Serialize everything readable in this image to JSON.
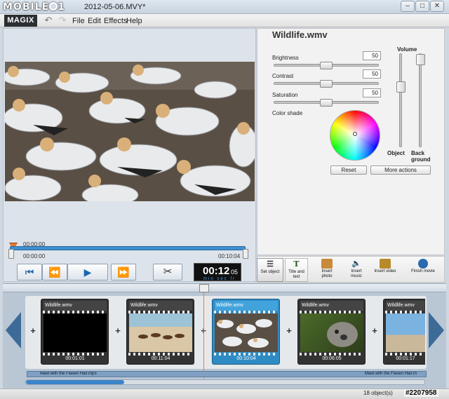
{
  "watermark": {
    "brand": "MOBILE01",
    "code": "#2207958"
  },
  "window": {
    "title": "2012-05-06.MVY*",
    "minimize": "–",
    "maximize": "□",
    "close": "✕"
  },
  "menu": {
    "logo": "MAGIX",
    "items": [
      "File",
      "Edit",
      "Effects",
      "Help"
    ]
  },
  "preview": {
    "scrub_top_time": "00:00:00",
    "scrub_start": "00:00:00",
    "scrub_end": "00:10:04"
  },
  "transport": {
    "timecode_main": "00:12",
    "timecode_frames": "05",
    "timecode_units": "min sec fr"
  },
  "properties": {
    "clip_title": "Wildlife.wmv",
    "brightness_label": "Brightness",
    "brightness_value": "50",
    "contrast_label": "Contrast",
    "contrast_value": "50",
    "saturation_label": "Saturation",
    "saturation_value": "50",
    "color_shade_label": "Color shade",
    "volume_label": "Volume",
    "object_label": "Object",
    "background_label_1": "Back",
    "background_label_2": "ground",
    "reset_label": "Reset",
    "more_actions_label": "More actions"
  },
  "actions": {
    "set_object": "Set object",
    "title_text_1": "Title and",
    "title_text_2": "text",
    "insert_photo_1": "Insert",
    "insert_photo_2": "photo",
    "insert_music_1": "Insert",
    "insert_music_2": "music",
    "insert_video": "Insert video",
    "finish_movie": "Finish movie"
  },
  "timeline": {
    "clips": [
      {
        "name": "Wildlife.wmv",
        "time": "00:01:01"
      },
      {
        "name": "Wildlife.wmv",
        "time": "00:11:04"
      },
      {
        "name": "Wildlife.wmv",
        "time": "00:10:04"
      },
      {
        "name": "Wildlife.wmv",
        "time": "00:06:05"
      },
      {
        "name": "Wildlife.wmv",
        "time": "00:01:17"
      }
    ],
    "audio_label": "Maid with the Flaxen Hair.mp3",
    "audio_label_2": "Maid with the Flaxen Hair.m"
  },
  "status": {
    "objects": "18 object(s)"
  },
  "colors": {
    "accent": "#2f8bc4",
    "playhead": "#f07a2a",
    "nav_arrow": "#3d6b98"
  }
}
